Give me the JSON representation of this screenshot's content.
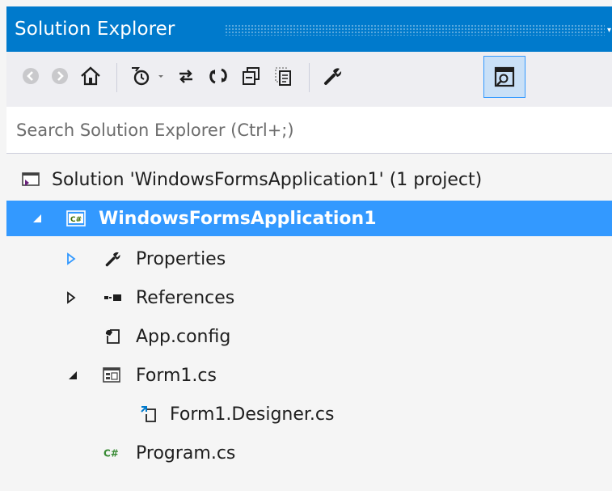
{
  "window": {
    "title": "Solution Explorer"
  },
  "toolbar": {
    "buttons": [
      {
        "name": "back-button",
        "icon": "back-arrow-icon"
      },
      {
        "name": "forward-button",
        "icon": "forward-arrow-icon"
      },
      {
        "name": "home-button",
        "icon": "home-icon"
      },
      {
        "name": "pending-changes-filter-button",
        "icon": "clock-filter-icon"
      },
      {
        "name": "sync-with-active-document-button",
        "icon": "sync-arrows-icon"
      },
      {
        "name": "refresh-button",
        "icon": "refresh-icon"
      },
      {
        "name": "collapse-all-button",
        "icon": "collapse-all-icon"
      },
      {
        "name": "show-all-files-button",
        "icon": "show-all-files-icon"
      },
      {
        "name": "properties-button",
        "icon": "wrench-icon"
      },
      {
        "name": "preview-selected-items-button",
        "icon": "preview-icon",
        "active": true
      }
    ]
  },
  "search": {
    "placeholder": "Search Solution Explorer (Ctrl+;)",
    "value": ""
  },
  "tree": {
    "items": [
      {
        "label": "Solution 'WindowsFormsApplication1' (1 project)",
        "icon": "solution-icon",
        "expander": "none"
      },
      {
        "label": "WindowsFormsApplication1",
        "icon": "csharp-project-icon",
        "expander": "expanded",
        "selected": true
      },
      {
        "label": "Properties",
        "icon": "wrench-icon",
        "expander": "collapsed-blue"
      },
      {
        "label": "References",
        "icon": "references-icon",
        "expander": "collapsed"
      },
      {
        "label": "App.config",
        "icon": "config-file-icon",
        "expander": "none"
      },
      {
        "label": "Form1.cs",
        "icon": "form-icon",
        "expander": "expanded"
      },
      {
        "label": "Form1.Designer.cs",
        "icon": "designer-file-icon",
        "expander": "none"
      },
      {
        "label": "Program.cs",
        "icon": "csharp-file-icon",
        "expander": "none"
      }
    ]
  },
  "colors": {
    "title_bar": "#007acc",
    "selection": "#3399ff",
    "toolbar": "#eeeef2",
    "background": "#f5f5f5"
  }
}
